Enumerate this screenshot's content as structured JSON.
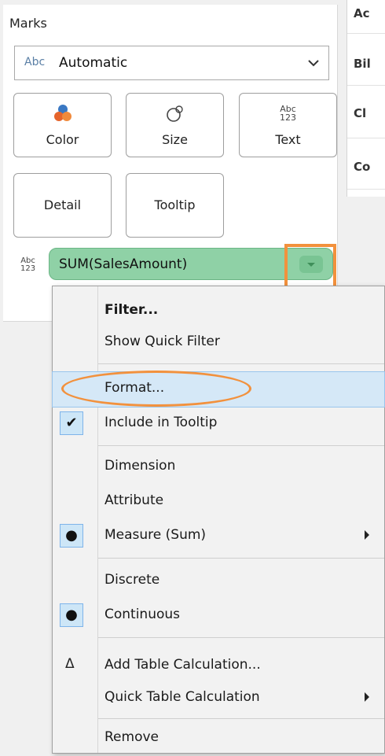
{
  "right_panel": {
    "items": [
      "Ac",
      "Bil",
      "Cl",
      "Co"
    ]
  },
  "marks": {
    "title": "Marks",
    "mark_type": {
      "abc_icon": "Abc",
      "value": "Automatic"
    },
    "buttons": {
      "color": "Color",
      "size": "Size",
      "text": "Text",
      "detail": "Detail",
      "tooltip": "Tooltip"
    },
    "text_icon_line1": "Abc",
    "text_icon_line2": "123",
    "pill": {
      "label": "SUM(SalesAmount)",
      "type_line1": "Abc",
      "type_line2": "123"
    }
  },
  "menu": {
    "items": [
      {
        "label": "Filter..."
      },
      {
        "label": "Show Quick Filter"
      },
      {
        "label": "Format..."
      },
      {
        "label": "Include in Tooltip",
        "check": "✔"
      },
      {
        "label": "Dimension"
      },
      {
        "label": "Attribute"
      },
      {
        "label": "Measure (Sum)",
        "check": "●"
      },
      {
        "label": "Discrete"
      },
      {
        "label": "Continuous",
        "check": "●"
      },
      {
        "label": "Add Table Calculation...",
        "icon": "Δ"
      },
      {
        "label": "Quick Table Calculation"
      },
      {
        "label": "Remove"
      }
    ]
  },
  "colors": {
    "pill_green": "#8fd1a6",
    "highlight_orange": "#f2913d",
    "menu_hover": "#d5e8f7"
  }
}
